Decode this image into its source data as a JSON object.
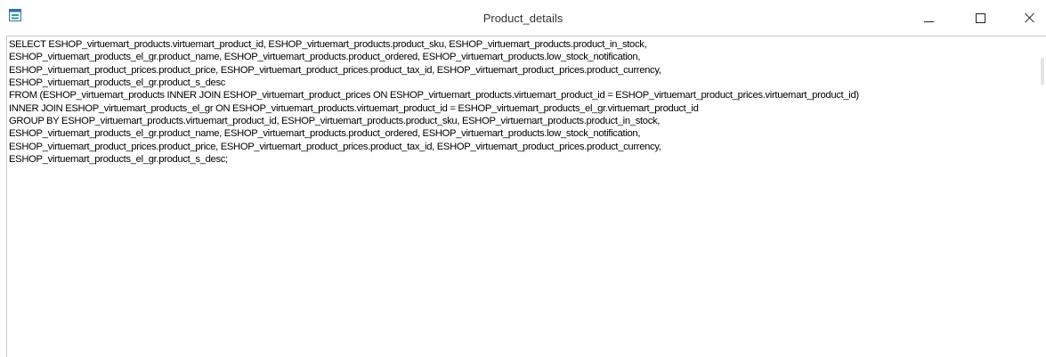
{
  "window": {
    "title": "Product_details",
    "icon": "form-icon",
    "controls": {
      "minimize_icon": "minimize-icon",
      "maximize_icon": "maximize-icon",
      "close_icon": "close-icon"
    }
  },
  "sql": {
    "lines": [
      "SELECT ESHOP_virtuemart_products.virtuemart_product_id, ESHOP_virtuemart_products.product_sku, ESHOP_virtuemart_products.product_in_stock,",
      "ESHOP_virtuemart_products_el_gr.product_name, ESHOP_virtuemart_products.product_ordered, ESHOP_virtuemart_products.low_stock_notification,",
      "ESHOP_virtuemart_product_prices.product_price, ESHOP_virtuemart_product_prices.product_tax_id, ESHOP_virtuemart_product_prices.product_currency,",
      "ESHOP_virtuemart_products_el_gr.product_s_desc",
      "FROM (ESHOP_virtuemart_products INNER JOIN ESHOP_virtuemart_product_prices ON ESHOP_virtuemart_products.virtuemart_product_id = ESHOP_virtuemart_product_prices.virtuemart_product_id)",
      "INNER JOIN ESHOP_virtuemart_products_el_gr ON ESHOP_virtuemart_products.virtuemart_product_id = ESHOP_virtuemart_products_el_gr.virtuemart_product_id",
      "GROUP BY ESHOP_virtuemart_products.virtuemart_product_id, ESHOP_virtuemart_products.product_sku, ESHOP_virtuemart_products.product_in_stock,",
      "ESHOP_virtuemart_products_el_gr.product_name, ESHOP_virtuemart_products.product_ordered, ESHOP_virtuemart_products.low_stock_notification,",
      "ESHOP_virtuemart_product_prices.product_price, ESHOP_virtuemart_product_prices.product_tax_id, ESHOP_virtuemart_product_prices.product_currency,",
      "ESHOP_virtuemart_products_el_gr.product_s_desc;"
    ]
  },
  "colors": {
    "icon_blue": "#2f6fb5",
    "icon_teal": "#2aa198"
  }
}
